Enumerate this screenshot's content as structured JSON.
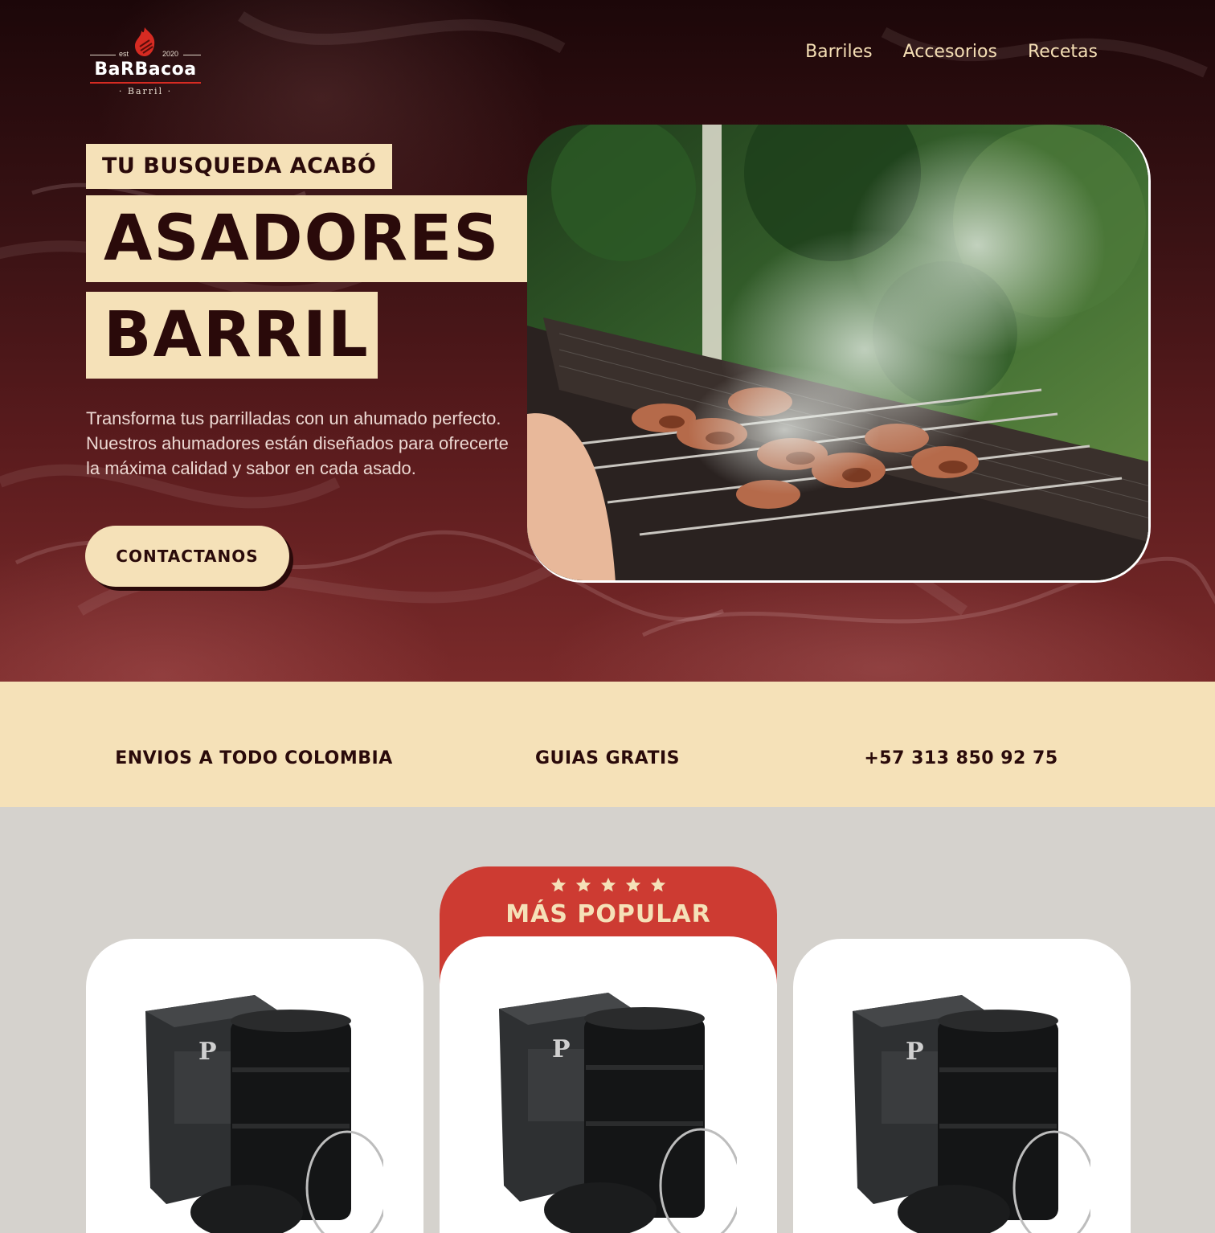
{
  "brand": {
    "est": "est",
    "year": "2020",
    "name": "BaRBacoa",
    "sub": "· Barril ·"
  },
  "nav": {
    "items": [
      {
        "label": "Barriles"
      },
      {
        "label": "Accesorios"
      },
      {
        "label": "Recetas"
      }
    ]
  },
  "hero": {
    "tag": "TU BUSQUEDA ACABÓ",
    "headline_line1": "ASADORES DE",
    "headline_line2": "BARRIL",
    "description": "Transforma tus parrilladas con un ahumado perfecto. Nuestros ahumadores están diseñados para ofrecerte la máxima calidad y sabor en cada asado.",
    "cta_label": "CONTACTANOS"
  },
  "features": {
    "shipping": "ENVIOS A TODO COLOMBIA",
    "guides": "GUIAS GRATIS",
    "phone": "+57 313 850 92 75"
  },
  "products": {
    "popular_label": "MÁS POPULAR",
    "popular_rating": 5
  },
  "colors": {
    "cream": "#f5e1b8",
    "dark": "#2a0a0a",
    "red": "#cd3b32",
    "bg": "#d5d2cd"
  }
}
